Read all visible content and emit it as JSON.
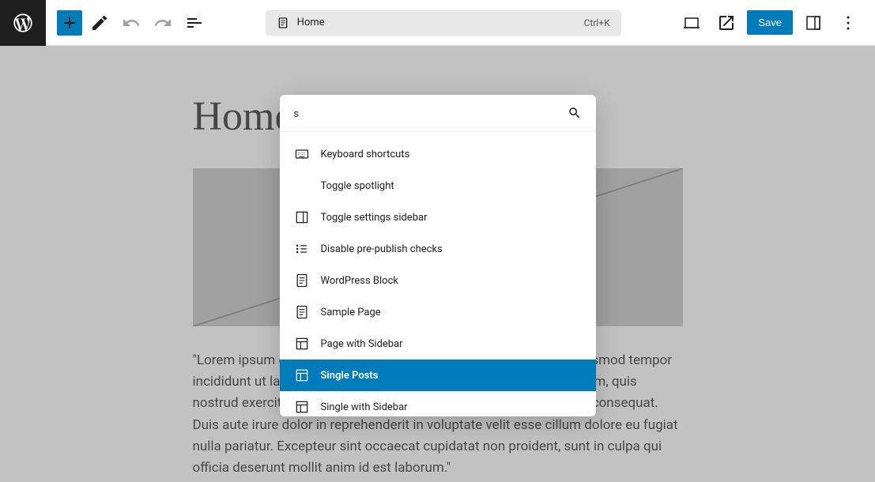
{
  "toolbar": {
    "doc_label": "Home",
    "shortcut": "Ctrl+K",
    "save_label": "Save"
  },
  "page": {
    "title": "Home",
    "body": "\"Lorem ipsum dolor sit amet, consectetur adipiscing elit, sed do eiusmod tempor incididunt ut labore et dolore magna aliqua. Ut enim ad minim veniam, quis nostrud exercitation ullamco laboris nisi ut aliquip ex ea commodo consequat. Duis aute irure dolor in reprehenderit in voluptate velit esse cillum dolore eu fugiat nulla pariatur. Excepteur sint occaecat cupidatat non proident, sunt in culpa qui officia deserunt mollit anim id est laborum.\""
  },
  "palette": {
    "query": "s",
    "items": [
      {
        "icon": "keyboard",
        "label": "Keyboard shortcuts",
        "selected": false
      },
      {
        "icon": "",
        "label": "Toggle spotlight",
        "selected": false
      },
      {
        "icon": "sidebar",
        "label": "Toggle settings sidebar",
        "selected": false
      },
      {
        "icon": "list",
        "label": "Disable pre-publish checks",
        "selected": false
      },
      {
        "icon": "page",
        "label": "WordPress Block",
        "selected": false
      },
      {
        "icon": "page",
        "label": "Sample Page",
        "selected": false
      },
      {
        "icon": "layout",
        "label": "Page with Sidebar",
        "selected": false
      },
      {
        "icon": "layout",
        "label": "Single Posts",
        "selected": true
      },
      {
        "icon": "layout",
        "label": "Single with Sidebar",
        "selected": false
      }
    ]
  }
}
